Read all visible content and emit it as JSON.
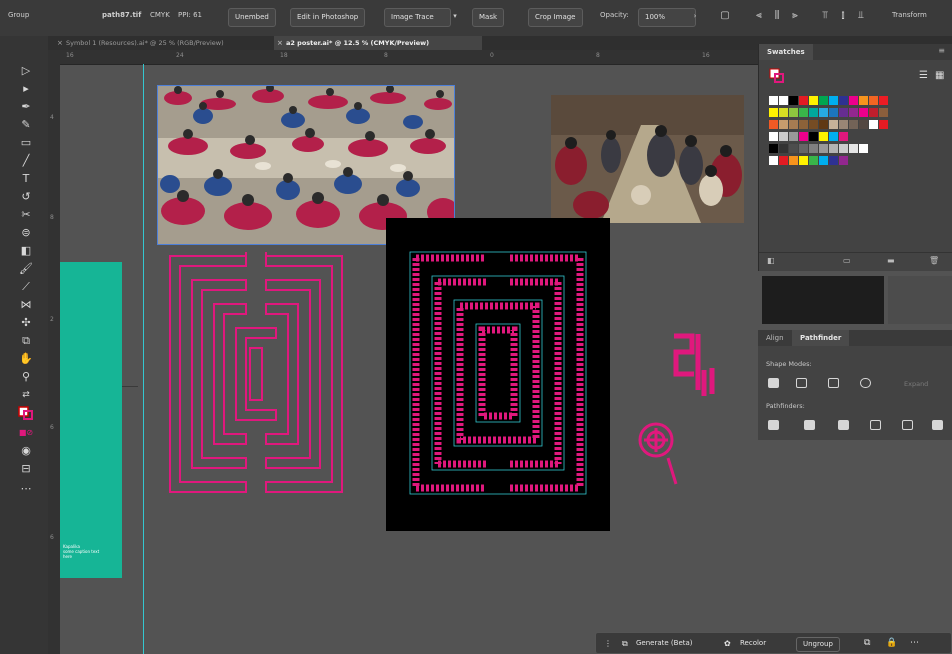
{
  "control_bar": {
    "selection_type": "Group",
    "document_info": "path87.tif",
    "color_mode": "CMYK",
    "ppi": "PPI: 61",
    "buttons": [
      "Unembed",
      "Edit in Photoshop",
      "Image Trace",
      "Mask",
      "Crop Image"
    ],
    "opacity_label": "Opacity:",
    "opacity_value": "100%",
    "transform_label": "Transform"
  },
  "tabs": [
    {
      "label": "Symbol 1 (Resources).ai* @ 25 % (RGB/Preview)",
      "active": false
    },
    {
      "label": "a2 poster.ai* @ 12.5 % (CMYK/Preview)",
      "active": true
    }
  ],
  "ruler_marks": [
    "16",
    "24",
    "18",
    "8",
    "0",
    "8",
    "16"
  ],
  "vruler_marks": [
    "4",
    "8",
    "2",
    "6",
    "6"
  ],
  "artboard_caption": [
    "Kapalika",
    "some caption text",
    "here"
  ],
  "swatches_panel": {
    "title": "Swatches"
  },
  "pathfinder_panel": {
    "tabs": [
      "Align",
      "Pathfinder"
    ],
    "shape_modes_label": "Shape Modes:",
    "expand_label": "Expand",
    "pathfinders_label": "Pathfinders:"
  },
  "context_bar": {
    "generate_label": "Generate (Beta)",
    "recolor_label": "Recolor",
    "ungroup_label": "Ungroup"
  },
  "colors": {
    "accent": "#16b596",
    "maze_pink": "#e0187d",
    "guide_cyan": "#34c7d0",
    "canvas_bg": "#535353"
  }
}
